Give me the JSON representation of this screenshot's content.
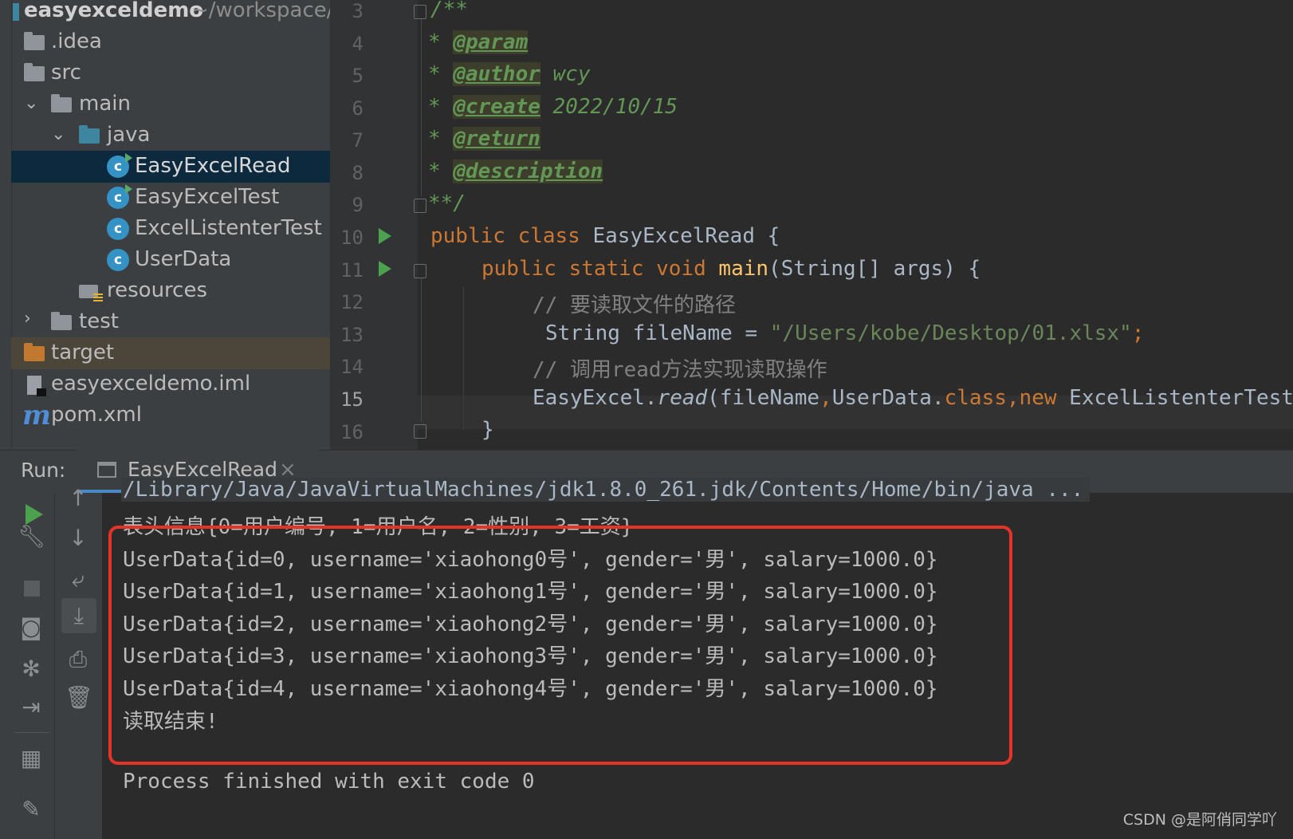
{
  "project_tree": {
    "root_name": "easyexceldemo",
    "root_path": "~/workspace/",
    "items": [
      {
        "label": ".idea"
      },
      {
        "label": "src"
      },
      {
        "label": "main"
      },
      {
        "label": "java"
      },
      {
        "label": "EasyExcelRead"
      },
      {
        "label": "EasyExcelTest"
      },
      {
        "label": "ExcelListenterTest"
      },
      {
        "label": "UserData"
      },
      {
        "label": "resources"
      },
      {
        "label": "test"
      },
      {
        "label": "target"
      },
      {
        "label": "easyexceldemo.iml"
      },
      {
        "label": "pom.xml"
      }
    ]
  },
  "editor": {
    "line_numbers": [
      "3",
      "4",
      "5",
      "6",
      "7",
      "8",
      "9",
      "10",
      "11",
      "12",
      "13",
      "14",
      "15",
      "16"
    ],
    "current_line": "15",
    "code": {
      "l3": "/**",
      "l4_star": "* ",
      "l4_tag": "@param",
      "l5_star": "* ",
      "l5_tag": "@author",
      "l5_text": " wcy",
      "l6_star": "* ",
      "l6_tag": "@create",
      "l6_text": " 2022/10/15",
      "l7_star": "* ",
      "l7_tag": "@return",
      "l8_star": "* ",
      "l8_tag": "@description",
      "l9": "**/",
      "l10_kw": "public class ",
      "l10_name": "EasyExcelRead {",
      "l11_kw": "public static void ",
      "l11_fn": "main",
      "l11_rest": "(String[] args) {",
      "l12": "// 要读取文件的路径",
      "l13_a": "String fileName = ",
      "l13_str": "\"/Users/kobe/Desktop/01.xlsx\"",
      "l13_end": ";",
      "l14": "// 调用read方法实现读取操作",
      "l15_a": "EasyExcel.",
      "l15_read": "read",
      "l15_b": "(fileName",
      "l15_c1": ",",
      "l15_d": "UserData.",
      "l15_cls": "class",
      "l15_c2": ",",
      "l15_new": "new ",
      "l15_e": "ExcelListenterTest",
      "l16": "}"
    }
  },
  "run_panel": {
    "label": "Run:",
    "tab_title": "EasyExcelRead",
    "close_glyph": "×",
    "output": [
      "/Library/Java/JavaVirtualMachines/jdk1.8.0_261.jdk/Contents/Home/bin/java ...",
      "表头信息{0=用户编号, 1=用户名, 2=性别, 3=工资}",
      "UserData{id=0, username='xiaohong0号', gender='男', salary=1000.0}",
      "UserData{id=1, username='xiaohong1号', gender='男', salary=1000.0}",
      "UserData{id=2, username='xiaohong2号', gender='男', salary=1000.0}",
      "UserData{id=3, username='xiaohong3号', gender='男', salary=1000.0}",
      "UserData{id=4, username='xiaohong4号', gender='男', salary=1000.0}",
      "读取结束!",
      "",
      "Process finished with exit code 0"
    ]
  },
  "watermark": "CSDN @是阿俏同学吖",
  "colors": {
    "selection": "#0d293e",
    "highlight_box": "#e5332a",
    "keyword": "#cc7832",
    "string": "#6a8759",
    "doc_comment": "#629755"
  }
}
